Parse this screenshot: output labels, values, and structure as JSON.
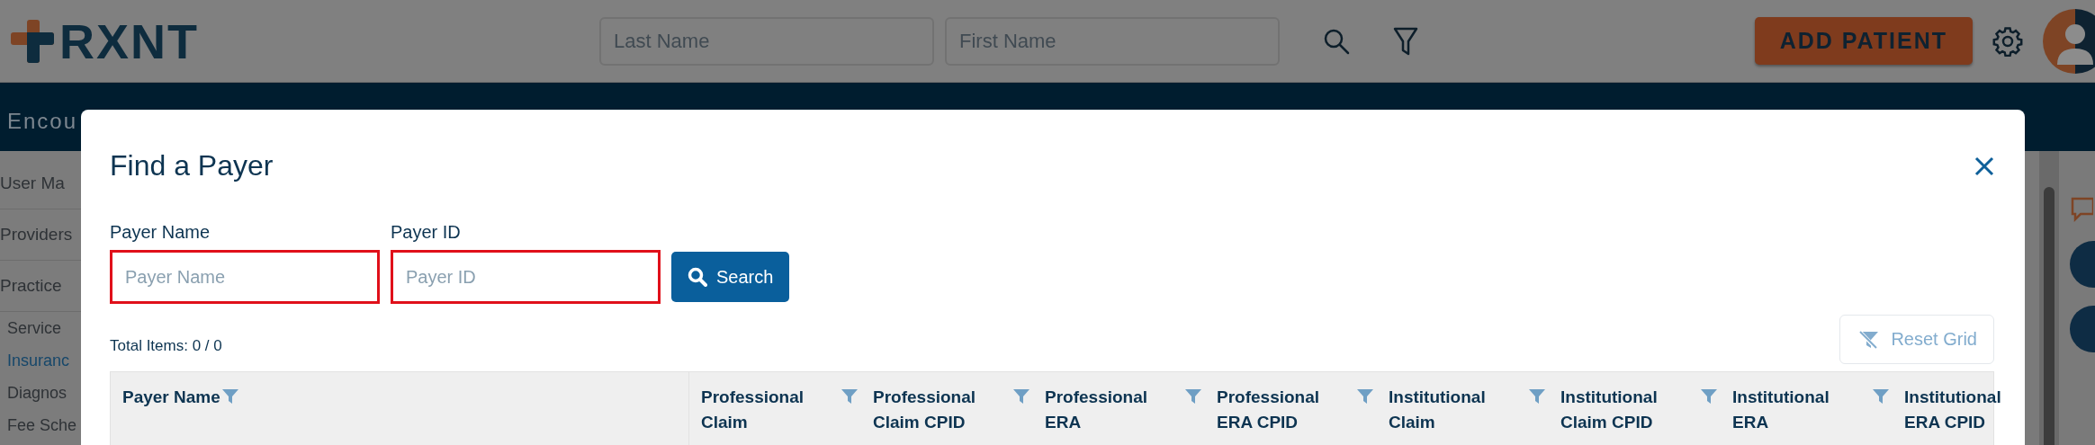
{
  "header": {
    "logo": "RXNT",
    "search_fields": [
      {
        "placeholder": "Last Name"
      },
      {
        "placeholder": "First Name"
      }
    ],
    "add_button": "ADD PATIENT"
  },
  "nav": {
    "label": "Encou"
  },
  "sidebar": [
    {
      "kind": "heading",
      "label": "User Ma",
      "selected": false
    },
    {
      "kind": "heading",
      "label": "Providers",
      "selected": false
    },
    {
      "kind": "heading",
      "label": "Practice",
      "selected": false
    },
    {
      "kind": "link",
      "label": "Service",
      "selected": false
    },
    {
      "kind": "link",
      "label": "Insuranc",
      "selected": true
    },
    {
      "kind": "link",
      "label": "Diagnos",
      "selected": false
    },
    {
      "kind": "link",
      "label": "Fee Sche",
      "selected": false
    }
  ],
  "dialog": {
    "title": "Find a Payer",
    "fields": [
      {
        "label": "Payer Name",
        "placeholder": "Payer Name",
        "invalid": true
      },
      {
        "label": "Payer ID",
        "placeholder": "Payer ID",
        "invalid": true
      }
    ],
    "search_button": "Search",
    "total_items": "Total Items: 0 / 0",
    "reset_button": {
      "label": "Reset Grid",
      "disabled": true
    },
    "table": {
      "columns": [
        {
          "label": "Payer Name",
          "filterable": true
        },
        {
          "label": "Professional Claim",
          "filterable": true
        },
        {
          "label": "Professional Claim CPID",
          "filterable": true
        },
        {
          "label": "Professional ERA",
          "filterable": true
        },
        {
          "label": "Professional ERA CPID",
          "filterable": true
        },
        {
          "label": "Institutional Claim",
          "filterable": true
        },
        {
          "label": "Institutional Claim CPID",
          "filterable": true
        },
        {
          "label": "Institutional ERA",
          "filterable": true
        },
        {
          "label": "Institutional ERA CPID",
          "filterable": false
        }
      ]
    }
  }
}
